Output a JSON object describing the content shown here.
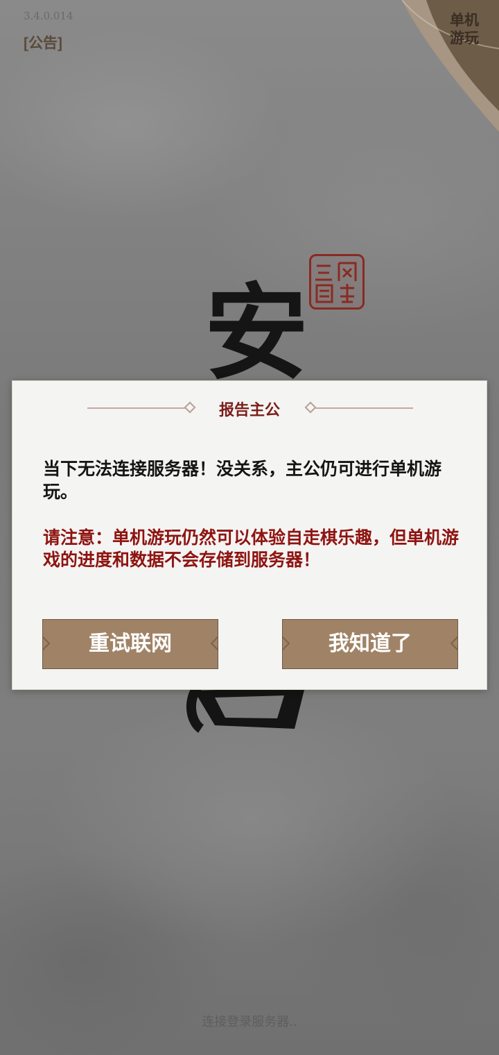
{
  "app": {
    "version": "3.4.0.014",
    "notice_label": "[公告]",
    "corner_label": "单机游玩",
    "calligraphy_top": "安",
    "status_text": "连接登录服务器.."
  },
  "dialog": {
    "title": "报告主公",
    "message": "当下无法连接服务器！没关系，主公仍可进行单机游玩。",
    "warning": "请注意：单机游玩仍然可以体验自走棋乐趣，但单机游戏的进度和数据不会存储到服务器！",
    "retry_button": "重试联网",
    "ok_button": "我知道了"
  },
  "colors": {
    "title_red": "#7a1e1a",
    "warning_red": "#8e1410",
    "button_brown": "#a08366",
    "seal_red": "#8a2a22"
  }
}
